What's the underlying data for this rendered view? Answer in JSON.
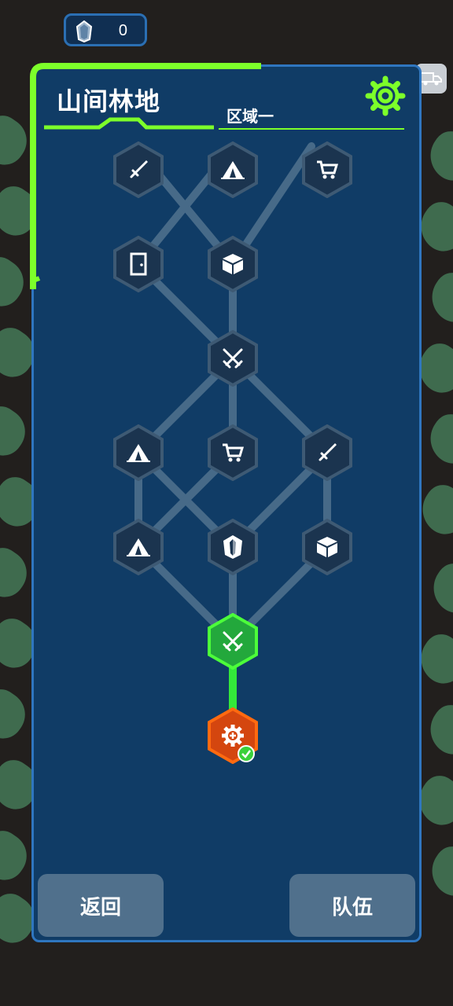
{
  "header": {
    "title": "山间林地",
    "subtitle": "区域一"
  },
  "currency": {
    "icon": "crystal-icon",
    "count": "0"
  },
  "buttons": {
    "back_label": "返回",
    "team_label": "队伍"
  },
  "colors": {
    "accent_green": "#7dff2a",
    "panel_blue": "#103c66",
    "node_fill": "#1b344f",
    "current_node": "#23a83c",
    "start_node": "#d4460f"
  },
  "map_nodes": [
    {
      "id": "r1-left",
      "icon": "sword-icon",
      "state": "locked"
    },
    {
      "id": "r1-mid",
      "icon": "tent-icon",
      "state": "locked"
    },
    {
      "id": "r1-right",
      "icon": "cart-icon",
      "state": "locked"
    },
    {
      "id": "r2-left",
      "icon": "door-icon",
      "state": "locked"
    },
    {
      "id": "r2-mid",
      "icon": "box-icon",
      "state": "locked"
    },
    {
      "id": "r3-mid",
      "icon": "crossed-swords-icon",
      "state": "locked"
    },
    {
      "id": "r4-left",
      "icon": "tent-icon",
      "state": "locked"
    },
    {
      "id": "r4-mid",
      "icon": "cart-icon",
      "state": "locked"
    },
    {
      "id": "r4-right",
      "icon": "sword-icon",
      "state": "locked"
    },
    {
      "id": "r5-left",
      "icon": "tent-icon",
      "state": "locked"
    },
    {
      "id": "r5-mid",
      "icon": "crystal-icon",
      "state": "locked"
    },
    {
      "id": "r5-right",
      "icon": "box-icon",
      "state": "locked"
    },
    {
      "id": "r6-mid",
      "icon": "crossed-swords-icon",
      "state": "current"
    },
    {
      "id": "r7-mid",
      "icon": "gear-heal-icon",
      "state": "completed"
    }
  ]
}
